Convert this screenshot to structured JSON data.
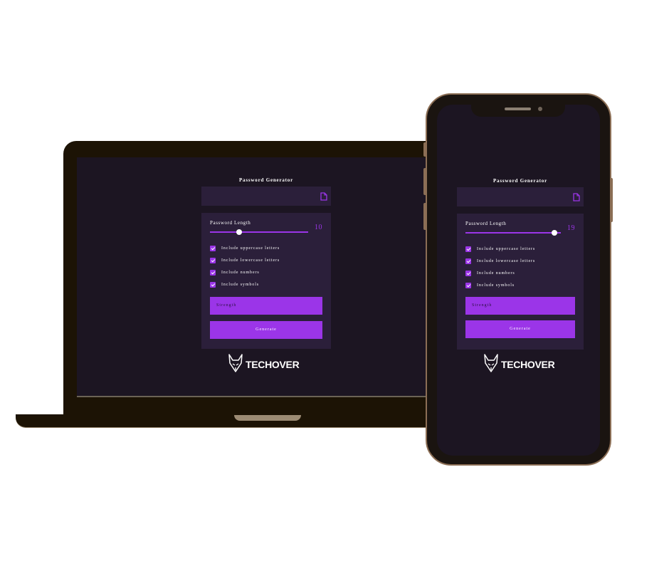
{
  "app": {
    "title": "Password Generator",
    "copy_icon": "copy-document-icon",
    "accent_color": "#9b35e8",
    "panel_color": "#2b1f3a",
    "background_color": "#1c1522",
    "length_label": "Password Length",
    "options": [
      {
        "label": "Include uppercase letters",
        "checked": true
      },
      {
        "label": "Include lowercase letters",
        "checked": true
      },
      {
        "label": "Include numbers",
        "checked": true
      },
      {
        "label": "Include symbols",
        "checked": true
      }
    ],
    "strength_label": "Strength",
    "generate_label": "Generate",
    "brand": "TECHOVER",
    "brand_icon": "fox-head-icon"
  },
  "laptop": {
    "length_value": "10",
    "slider_fraction": 0.3
  },
  "phone": {
    "length_value": "19",
    "slider_fraction": 0.93
  }
}
